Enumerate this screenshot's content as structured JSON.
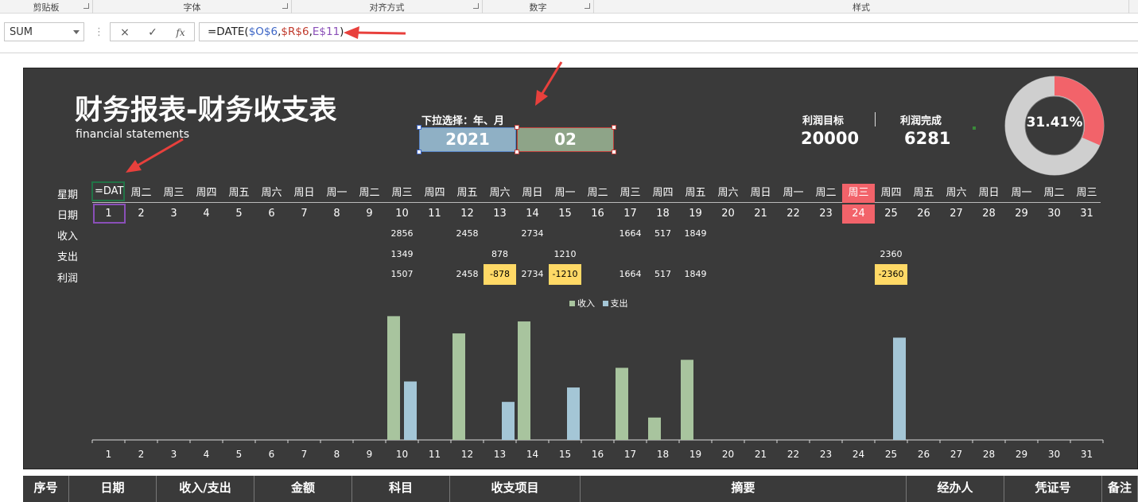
{
  "ribbon": {
    "groups": [
      {
        "label": "剪贴板"
      },
      {
        "label": "字体"
      },
      {
        "label": "对齐方式"
      },
      {
        "label": "数字"
      },
      {
        "label": "样式"
      }
    ]
  },
  "formula_bar": {
    "name_box": "SUM",
    "cancel_icon": "×",
    "enter_icon": "✓",
    "fx_label": "fx",
    "formula_prefix": "=DATE(",
    "ref1": "$O$6",
    "comma1": ",",
    "ref2": "$R$6",
    "comma2": ",",
    "ref3": "E$11",
    "formula_suffix": ")"
  },
  "dashboard": {
    "title": "财务报表-财务收支表",
    "subtitle": "financial statements",
    "select_label": "下拉选择：年、月",
    "year": "2021",
    "month": "02",
    "profit_target_label": "利润目标",
    "profit_target_value": "20000",
    "profit_done_label": "利润完成",
    "profit_done_value": "6281",
    "completion_rate": 0.3141,
    "completion_text": "31.41%",
    "colors": {
      "background": "#3a3a3a",
      "donut_fill": "#f2636a",
      "donut_track": "#d0d0d0"
    }
  },
  "grid": {
    "row_labels": {
      "week": "星期",
      "day": "日期",
      "income": "收入",
      "expense": "支出",
      "profit": "利润"
    },
    "editing_cell": "=DAT",
    "weekdays": [
      "",
      "周二",
      "周三",
      "周四",
      "周五",
      "周六",
      "周日",
      "周一",
      "周二",
      "周三",
      "周四",
      "周五",
      "周六",
      "周日",
      "周一",
      "周二",
      "周三",
      "周四",
      "周五",
      "周六",
      "周日",
      "周一",
      "周二",
      "周三",
      "周四",
      "周五",
      "周六",
      "周日",
      "周一",
      "周二",
      "周三"
    ],
    "days": [
      "1",
      "2",
      "3",
      "4",
      "5",
      "6",
      "7",
      "8",
      "9",
      "10",
      "11",
      "12",
      "13",
      "14",
      "15",
      "16",
      "17",
      "18",
      "19",
      "20",
      "21",
      "22",
      "23",
      "24",
      "25",
      "26",
      "27",
      "28",
      "29",
      "30",
      "31"
    ],
    "income": [
      "",
      "",
      "",
      "",
      "",
      "",
      "",
      "",
      "",
      "2856",
      "",
      "2458",
      "",
      "2734",
      "",
      "",
      "1664",
      "517",
      "1849",
      "",
      "",
      "",
      "",
      "",
      "",
      "",
      "",
      "",
      "",
      "",
      ""
    ],
    "expense": [
      "",
      "",
      "",
      "",
      "",
      "",
      "",
      "",
      "",
      "1349",
      "",
      "",
      "878",
      "",
      "1210",
      "",
      "",
      "",
      "",
      "",
      "",
      "",
      "",
      "",
      "2360",
      "",
      "",
      "",
      "",
      "",
      ""
    ],
    "profit": [
      "",
      "",
      "",
      "",
      "",
      "",
      "",
      "",
      "",
      "1507",
      "",
      "2458",
      "-878",
      "2734",
      "-1210",
      "",
      "1664",
      "517",
      "1849",
      "",
      "",
      "",
      "",
      "",
      "-2360",
      "",
      "",
      "",
      "",
      "",
      ""
    ],
    "highlight_day": "24"
  },
  "chart_data": {
    "type": "bar",
    "legend": [
      "收入",
      "支出"
    ],
    "categories": [
      "1",
      "2",
      "3",
      "4",
      "5",
      "6",
      "7",
      "8",
      "9",
      "10",
      "11",
      "12",
      "13",
      "14",
      "15",
      "16",
      "17",
      "18",
      "19",
      "20",
      "21",
      "22",
      "23",
      "24",
      "25",
      "26",
      "27",
      "28",
      "29",
      "30",
      "31"
    ],
    "series": [
      {
        "name": "收入",
        "color": "#a8c49e",
        "values": [
          0,
          0,
          0,
          0,
          0,
          0,
          0,
          0,
          0,
          2856,
          0,
          2458,
          0,
          2734,
          0,
          0,
          1664,
          517,
          1849,
          0,
          0,
          0,
          0,
          0,
          0,
          0,
          0,
          0,
          0,
          0,
          0
        ]
      },
      {
        "name": "支出",
        "color": "#a4c6d6",
        "values": [
          0,
          0,
          0,
          0,
          0,
          0,
          0,
          0,
          0,
          1349,
          0,
          0,
          878,
          0,
          1210,
          0,
          0,
          0,
          0,
          0,
          0,
          0,
          0,
          0,
          2360,
          0,
          0,
          0,
          0,
          0,
          0
        ]
      }
    ],
    "ylim": [
      0,
      2900
    ],
    "grid": false,
    "legend_position": "top-center"
  },
  "table_header": {
    "columns": [
      "序号",
      "日期",
      "收入/支出",
      "金额",
      "科目",
      "收支项目",
      "摘要",
      "经办人",
      "凭证号",
      "备注"
    ]
  }
}
